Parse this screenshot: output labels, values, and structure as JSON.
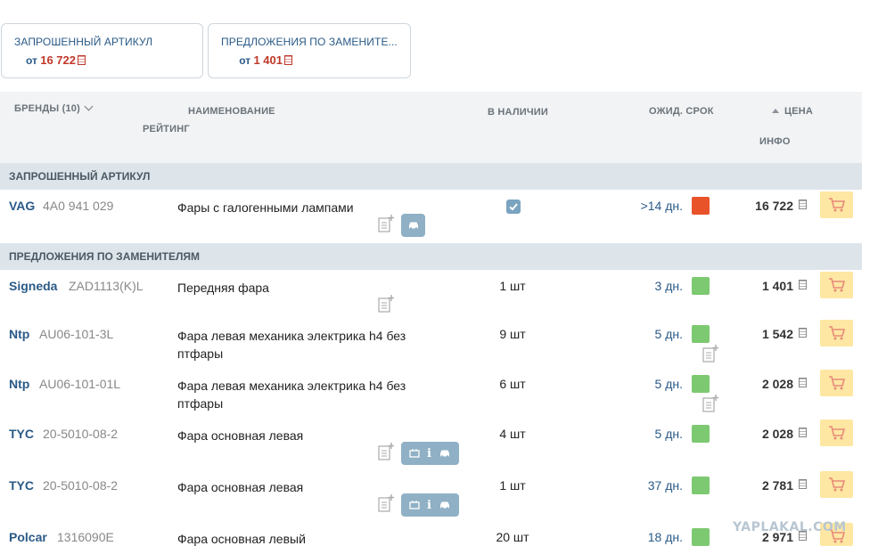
{
  "summary": {
    "requested": {
      "title": "ЗАПРОШЕННЫЙ АРТИКУЛ",
      "prefix": "от",
      "price": "16 722"
    },
    "replacements": {
      "title": "ПРЕДЛОЖЕНИЯ ПО ЗАМЕНИТЕ...",
      "prefix": "от",
      "price": "1 401"
    }
  },
  "header": {
    "brands": "БРЕНДЫ (10)",
    "name": "НАИМЕНОВАНИЕ",
    "rating": "РЕЙТИНГ",
    "stock": "В НАЛИЧИИ",
    "eta": "ОЖИД. СРОК",
    "price": "ЦЕНА",
    "info": "ИНФО"
  },
  "sections": {
    "requested": "ЗАПРОШЕННЫЙ АРТИКУЛ",
    "replacements": "ПРЕДЛОЖЕНИЯ ПО ЗАМЕНИТЕЛЯМ"
  },
  "requested_row": {
    "brand": "VAG",
    "code": "4A0 941 029",
    "name": "Фары с галогенными лампами",
    "days": ">14 дн.",
    "price": "16 722",
    "in_stock": true
  },
  "rows": [
    {
      "brand": "Signeda",
      "code": "ZAD1113(K)L",
      "name": "Передняя фара",
      "stock": "1 шт",
      "days": "3 дн.",
      "price": "1 401"
    },
    {
      "brand": "Ntp",
      "code": "AU06-101-3L",
      "name": "Фара левая механика электрика h4 без птфары",
      "stock": "9 шт",
      "days": "5 дн.",
      "price": "1 542"
    },
    {
      "brand": "Ntp",
      "code": "AU06-101-01L",
      "name": "Фара левая механика электрика h4 без птфары",
      "stock": "6 шт",
      "days": "5 дн.",
      "price": "2 028"
    },
    {
      "brand": "TYC",
      "code": "20-5010-08-2",
      "name": "Фара основная левая",
      "stock": "4 шт",
      "days": "5 дн.",
      "price": "2 028"
    },
    {
      "brand": "TYC",
      "code": "20-5010-08-2",
      "name": "Фара основная левая",
      "stock": "1 шт",
      "days": "37 дн.",
      "price": "2 781"
    },
    {
      "brand": "Polcar",
      "code": "1316090E",
      "name": "Фара основная левый",
      "stock": "20 шт",
      "days": "18 дн.",
      "price": "2 971"
    }
  ],
  "watermark": "YAPLAKAL.COM",
  "colors": {
    "accent": "#2a5a87",
    "price_red": "#c0392b",
    "status_red": "#e8532a",
    "status_green": "#7dc971",
    "cart_bg": "#fde7a3",
    "badge": "#8fb0c5"
  },
  "icons": {
    "note": "note-add-icon",
    "car": "car-icon",
    "info": "info-icon",
    "battery": "battery-icon",
    "cart": "cart-icon",
    "check": "check-icon",
    "currency": "ruble-icon"
  }
}
